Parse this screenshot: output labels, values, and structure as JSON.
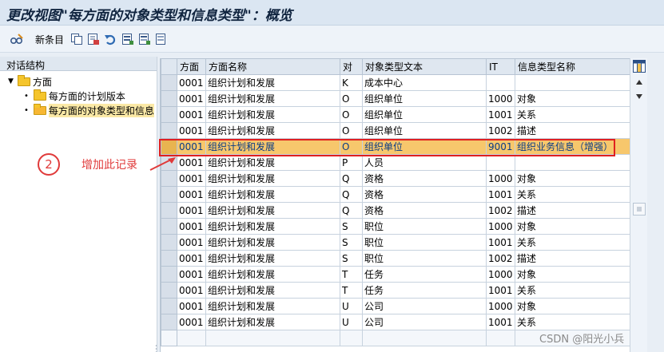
{
  "window": {
    "title": "更改视图\"每方面的对象类型和信息类型\"：概览"
  },
  "toolbar": {
    "new_entries_label": "新条目",
    "icons": [
      "glasses-edit-icon",
      "copy-icon",
      "delete-icon",
      "undo-icon",
      "select-all-icon",
      "select-block-icon",
      "deselect-all-icon"
    ]
  },
  "left_panel": {
    "header": "对话结构",
    "tree": [
      {
        "label": "方面",
        "level": 0,
        "expanded": true
      },
      {
        "label": "每方面的计划版本",
        "level": 1
      },
      {
        "label": "每方面的对象类型和信息",
        "level": 1,
        "selected": true
      }
    ]
  },
  "table": {
    "columns": [
      "方面",
      "方面名称",
      "对",
      "对象类型文本",
      "IT",
      "信息类型名称"
    ],
    "rows": [
      [
        "0001",
        "组织计划和发展",
        "K",
        "成本中心",
        "",
        ""
      ],
      [
        "0001",
        "组织计划和发展",
        "O",
        "组织单位",
        "1000",
        "对象"
      ],
      [
        "0001",
        "组织计划和发展",
        "O",
        "组织单位",
        "1001",
        "关系"
      ],
      [
        "0001",
        "组织计划和发展",
        "O",
        "组织单位",
        "1002",
        "描述"
      ],
      [
        "0001",
        "组织计划和发展",
        "O",
        "组织单位",
        "9001",
        "组织业务信息（增强）"
      ],
      [
        "0001",
        "组织计划和发展",
        "P",
        "人员",
        "",
        ""
      ],
      [
        "0001",
        "组织计划和发展",
        "Q",
        "资格",
        "1000",
        "对象"
      ],
      [
        "0001",
        "组织计划和发展",
        "Q",
        "资格",
        "1001",
        "关系"
      ],
      [
        "0001",
        "组织计划和发展",
        "Q",
        "资格",
        "1002",
        "描述"
      ],
      [
        "0001",
        "组织计划和发展",
        "S",
        "职位",
        "1000",
        "对象"
      ],
      [
        "0001",
        "组织计划和发展",
        "S",
        "职位",
        "1001",
        "关系"
      ],
      [
        "0001",
        "组织计划和发展",
        "S",
        "职位",
        "1002",
        "描述"
      ],
      [
        "0001",
        "组织计划和发展",
        "T",
        "任务",
        "1000",
        "对象"
      ],
      [
        "0001",
        "组织计划和发展",
        "T",
        "任务",
        "1001",
        "关系"
      ],
      [
        "0001",
        "组织计划和发展",
        "U",
        "公司",
        "1000",
        "对象"
      ],
      [
        "0001",
        "组织计划和发展",
        "U",
        "公司",
        "1001",
        "关系"
      ]
    ],
    "highlighted_row": 4
  },
  "annotation": {
    "number": "2",
    "text": "增加此记录",
    "color": "#e03a3a"
  },
  "watermark": "CSDN @阳光小兵",
  "colors": {
    "highlight_row": "#f7c76c",
    "highlight_border": "#e02020",
    "title_bg": "#dbe6f2"
  }
}
